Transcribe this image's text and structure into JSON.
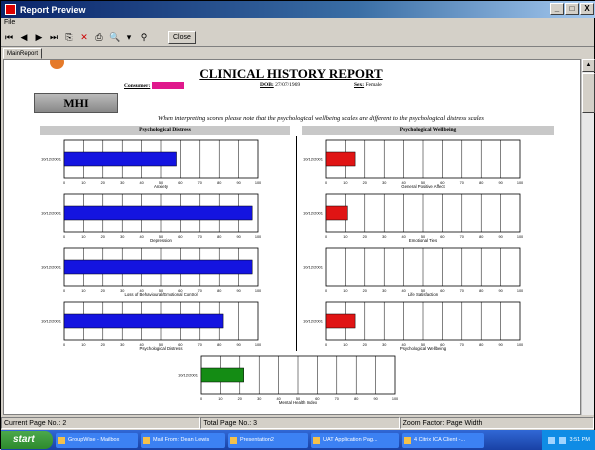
{
  "window": {
    "title": "Report Preview",
    "minimize": "_",
    "maximize": "□",
    "close": "X"
  },
  "menu": {
    "file": "File"
  },
  "toolbar": {
    "first": "⏮",
    "prev": "◀",
    "next": "▶",
    "last": "⏭",
    "export": "⎘",
    "cancel": "✕",
    "print": "⎙",
    "zoom": "🔍",
    "zoom_drop": "▾",
    "search": "⚲",
    "close_label": "Close"
  },
  "tab": {
    "label": "MainReport"
  },
  "report": {
    "title": "CLINICAL HISTORY REPORT",
    "consumer_label": "Consumer:",
    "dob_label": "DOB:",
    "dob_value": "27/07/1969",
    "sex_label": "Sex:",
    "sex_value": "Female",
    "section_label": "MHI",
    "note": "When interpreting scores please note that the psychological wellbeing scales are different to the psychological distress scales",
    "distress_header": "Psychological Distress",
    "wellbeing_header": "Psychological Wellbeing"
  },
  "chart_data": [
    {
      "type": "bar",
      "title": "Anxiety",
      "categories": [
        "10/12/2001"
      ],
      "values": [
        58
      ],
      "xlim": [
        0,
        100
      ],
      "ticks": [
        0,
        10,
        20,
        30,
        40,
        50,
        60,
        70,
        80,
        90,
        100
      ],
      "color": "#1414e0"
    },
    {
      "type": "bar",
      "title": "Depression",
      "categories": [
        "10/12/2001"
      ],
      "values": [
        97
      ],
      "xlim": [
        0,
        100
      ],
      "ticks": [
        0,
        10,
        20,
        30,
        40,
        50,
        60,
        70,
        80,
        90,
        100
      ],
      "color": "#1414e0"
    },
    {
      "type": "bar",
      "title": "Loss of Behavioural/Emotional Control",
      "categories": [
        "10/12/2001"
      ],
      "values": [
        97
      ],
      "xlim": [
        0,
        100
      ],
      "ticks": [
        0,
        10,
        20,
        30,
        40,
        50,
        60,
        70,
        80,
        90,
        100
      ],
      "color": "#1414e0"
    },
    {
      "type": "bar",
      "title": "Psychological Distress",
      "categories": [
        "10/12/2001"
      ],
      "values": [
        82
      ],
      "xlim": [
        0,
        100
      ],
      "ticks": [
        0,
        10,
        20,
        30,
        40,
        50,
        60,
        70,
        80,
        90,
        100
      ],
      "color": "#1414e0"
    },
    {
      "type": "bar",
      "title": "General Positive Affect",
      "categories": [
        "10/12/2001"
      ],
      "values": [
        15
      ],
      "xlim": [
        0,
        100
      ],
      "ticks": [
        0,
        10,
        20,
        30,
        40,
        50,
        60,
        70,
        80,
        90,
        100
      ],
      "color": "#e01414"
    },
    {
      "type": "bar",
      "title": "Emotional Ties",
      "categories": [
        "10/12/2001"
      ],
      "values": [
        11
      ],
      "xlim": [
        0,
        100
      ],
      "ticks": [
        0,
        10,
        20,
        30,
        40,
        50,
        60,
        70,
        80,
        90,
        100
      ],
      "color": "#e01414"
    },
    {
      "type": "bar",
      "title": "Life Satisfaction",
      "categories": [
        "10/12/2001"
      ],
      "values": [
        0
      ],
      "xlim": [
        0,
        100
      ],
      "ticks": [
        0,
        10,
        20,
        30,
        40,
        50,
        60,
        70,
        80,
        90,
        100
      ],
      "color": "#e01414"
    },
    {
      "type": "bar",
      "title": "Psychological Wellbeing",
      "categories": [
        "10/12/2001"
      ],
      "values": [
        15
      ],
      "xlim": [
        0,
        100
      ],
      "ticks": [
        0,
        10,
        20,
        30,
        40,
        50,
        60,
        70,
        80,
        90,
        100
      ],
      "color": "#e01414"
    },
    {
      "type": "bar",
      "title": "Mental Health Index",
      "categories": [
        "10/12/2001"
      ],
      "values": [
        22
      ],
      "xlim": [
        0,
        100
      ],
      "ticks": [
        0,
        10,
        20,
        30,
        40,
        50,
        60,
        70,
        80,
        90,
        100
      ],
      "color": "#148c14"
    }
  ],
  "status": {
    "current_page": "Current Page No.: 2",
    "total_page": "Total Page No.: 3",
    "zoom": "Zoom Factor: Page Width"
  },
  "taskbar": {
    "start": "start",
    "tasks": [
      "GroupWise - Mailbox",
      "Mail From: Dean Lewis",
      "Presentation2",
      "UAT Application Pag...",
      "4 Citrix ICA Client -..."
    ],
    "clock": "3:51 PM"
  }
}
